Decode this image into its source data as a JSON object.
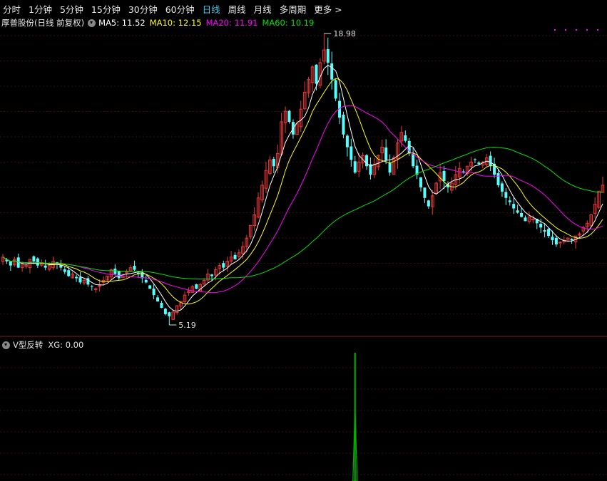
{
  "toolbar": {
    "items": [
      "分时",
      "1分钟",
      "5分钟",
      "15分钟",
      "30分钟",
      "60分钟",
      "日线",
      "周线",
      "月线",
      "多周期",
      "更多 >"
    ],
    "active_index": 6
  },
  "main_chart": {
    "stock_title": "厚普股份(日线 前复权)",
    "ma5": {
      "label": "MA5: 11.52",
      "color": "#ffffff"
    },
    "ma10": {
      "label": "MA10: 12.15",
      "color": "#ffff00"
    },
    "ma20": {
      "label": "MA20: 11.91",
      "color": "#ff00ff"
    },
    "ma60": {
      "label": "MA60: 10.19",
      "color": "#00e000"
    },
    "high_label": "18.98",
    "low_label": "5.19",
    "up_color": "#e83838",
    "down_color": "#54ffff"
  },
  "indicator": {
    "title": "V型反转",
    "value_label": "XG: 0.00",
    "signal_color": "#00b000"
  },
  "chart_data": {
    "type": "candlestick",
    "price_range": [
      5.19,
      18.98
    ],
    "closes": [
      8.4,
      8.2,
      8.0,
      8.3,
      7.9,
      8.1,
      8.0,
      8.3,
      8.2,
      8.0,
      8.1,
      7.9,
      8.0,
      8.2,
      8.1,
      7.9,
      7.7,
      7.5,
      7.6,
      7.4,
      7.2,
      7.3,
      7.1,
      7.0,
      6.9,
      7.1,
      7.3,
      7.5,
      7.8,
      7.6,
      7.4,
      7.5,
      7.7,
      7.9,
      7.8,
      7.6,
      7.4,
      7.2,
      6.9,
      6.6,
      6.3,
      6.0,
      5.7,
      5.6,
      5.8,
      6.1,
      6.3,
      6.6,
      6.8,
      7.0,
      6.9,
      7.1,
      7.3,
      7.6,
      7.5,
      7.8,
      8.0,
      7.9,
      8.2,
      8.4,
      8.3,
      8.6,
      8.9,
      9.3,
      9.9,
      10.4,
      11.2,
      11.8,
      12.5,
      13.0,
      12.7,
      13.3,
      14.8,
      15.3,
      14.8,
      14.2,
      14.7,
      15.4,
      16.2,
      16.8,
      17.4,
      16.6,
      17.6,
      18.2,
      17.6,
      16.8,
      15.9,
      15.0,
      14.2,
      13.6,
      13.0,
      12.4,
      12.9,
      13.2,
      12.7,
      12.3,
      12.8,
      13.2,
      13.6,
      13.0,
      12.4,
      13.1,
      13.8,
      14.3,
      13.9,
      13.3,
      12.7,
      12.3,
      11.7,
      11.2,
      10.8,
      11.3,
      11.9,
      12.4,
      12.0,
      11.7,
      11.9,
      12.3,
      12.6,
      12.4,
      12.7,
      12.9,
      13.0,
      12.8,
      12.9,
      13.1,
      12.7,
      12.3,
      11.8,
      11.5,
      11.2,
      11.0,
      10.7,
      10.5,
      10.3,
      10.1,
      10.3,
      10.2,
      10.0,
      9.8,
      9.6,
      9.4,
      9.2,
      9.0,
      9.1,
      9.2,
      9.3,
      9.2,
      9.4,
      9.5,
      9.8,
      10.0,
      10.4,
      10.9,
      11.52,
      11.8
    ],
    "xg_signal": {
      "bar_index": 91,
      "value": 1,
      "current": 0.0
    }
  }
}
